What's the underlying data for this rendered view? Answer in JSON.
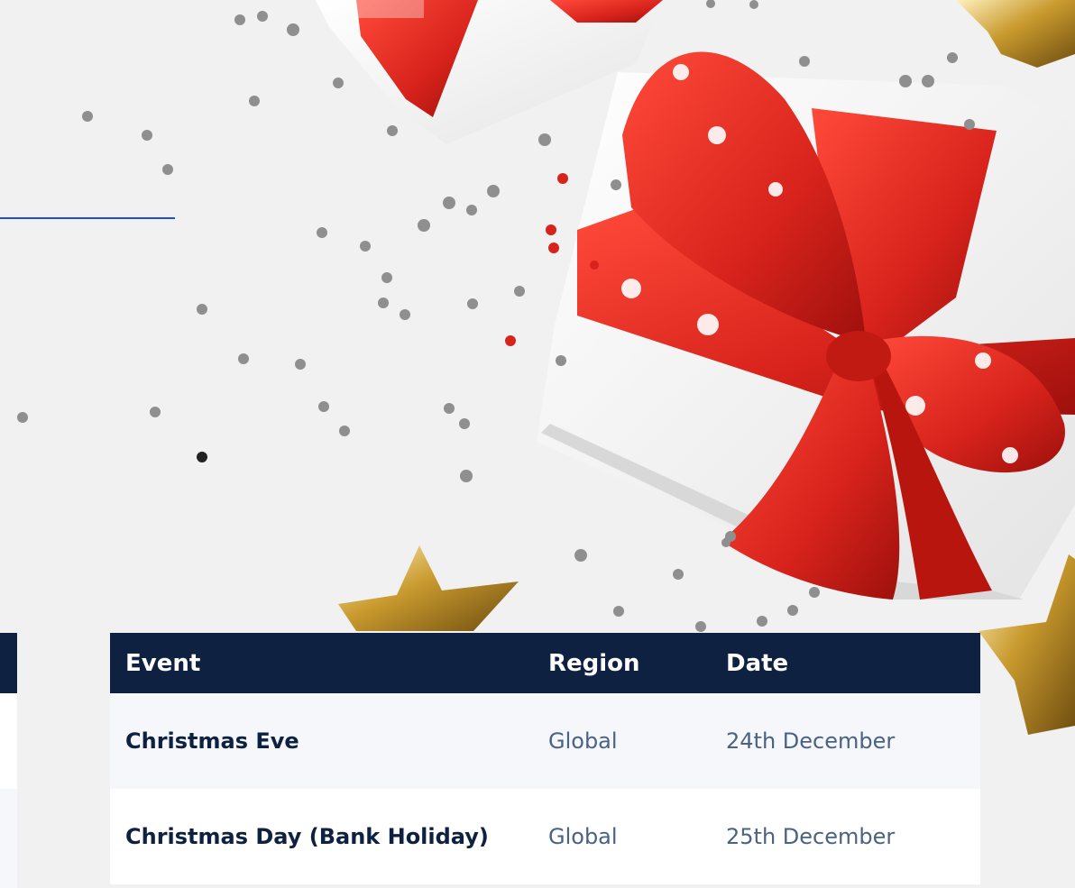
{
  "colors": {
    "header_bg": "#0e2141",
    "accent_line": "#1f4fd6",
    "ribbon_red": "#d8231c",
    "gold": "#c99a2e",
    "row_alt": "#f5f7fb"
  },
  "table": {
    "headers": {
      "event": "Event",
      "region": "Region",
      "date": "Date"
    },
    "rows": [
      {
        "event": "Christmas Eve",
        "region": "Global",
        "date": "24th December"
      },
      {
        "event": "Christmas Day (Bank Holiday)",
        "region": "Global",
        "date": "25th December"
      }
    ]
  }
}
